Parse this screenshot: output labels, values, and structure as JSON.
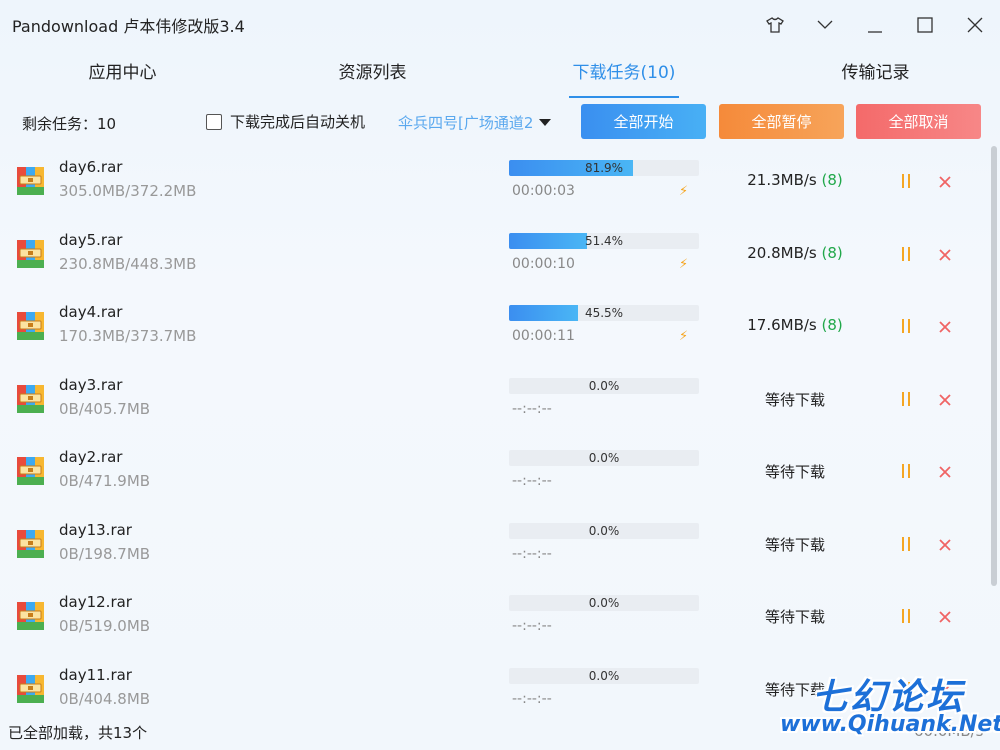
{
  "window": {
    "title": "Pandownload 卢本伟修改版3.4"
  },
  "tabs": [
    {
      "label": "应用中心"
    },
    {
      "label": "资源列表"
    },
    {
      "label": "下载任务(10)"
    },
    {
      "label": "传输记录"
    }
  ],
  "toolbar": {
    "remaining": "剩余任务：10",
    "auto_shutdown": "下载完成后自动关机",
    "channel": "伞兵四号[广场通道2",
    "start_all": "全部开始",
    "pause_all": "全部暂停",
    "cancel_all": "全部取消"
  },
  "tasks": [
    {
      "name": "day6.rar",
      "size": "305.0MB/372.2MB",
      "progress": 81.9,
      "progress_text": "81.9%",
      "eta": "00:00:03",
      "speed": "21.3MB/s",
      "threads": "(8)"
    },
    {
      "name": "day5.rar",
      "size": "230.8MB/448.3MB",
      "progress": 51.4,
      "progress_text": "51.4%",
      "eta": "00:00:10",
      "speed": "20.8MB/s",
      "threads": "(8)"
    },
    {
      "name": "day4.rar",
      "size": "170.3MB/373.7MB",
      "progress": 45.5,
      "progress_text": "45.5%",
      "eta": "00:00:11",
      "speed": "17.6MB/s",
      "threads": "(8)"
    },
    {
      "name": "day3.rar",
      "size": "0B/405.7MB",
      "progress": 0,
      "progress_text": "0.0%",
      "eta": "--:--:--",
      "status": "等待下载"
    },
    {
      "name": "day2.rar",
      "size": "0B/471.9MB",
      "progress": 0,
      "progress_text": "0.0%",
      "eta": "--:--:--",
      "status": "等待下载"
    },
    {
      "name": "day13.rar",
      "size": "0B/198.7MB",
      "progress": 0,
      "progress_text": "0.0%",
      "eta": "--:--:--",
      "status": "等待下载"
    },
    {
      "name": "day12.rar",
      "size": "0B/519.0MB",
      "progress": 0,
      "progress_text": "0.0%",
      "eta": "--:--:--",
      "status": "等待下载"
    },
    {
      "name": "day11.rar",
      "size": "0B/404.8MB",
      "progress": 0,
      "progress_text": "0.0%",
      "eta": "--:--:--",
      "status": "等待下载"
    }
  ],
  "status": {
    "text": "已全部加载，共13个",
    "speed": "60.0MB/s"
  },
  "watermark": {
    "cn": "七幻论坛",
    "en": "www.Qihuank.Net"
  },
  "colors": {
    "accent": "#2f8fe8",
    "threads": "#21a84a",
    "pause": "#f5a623",
    "close": "#f06464"
  }
}
